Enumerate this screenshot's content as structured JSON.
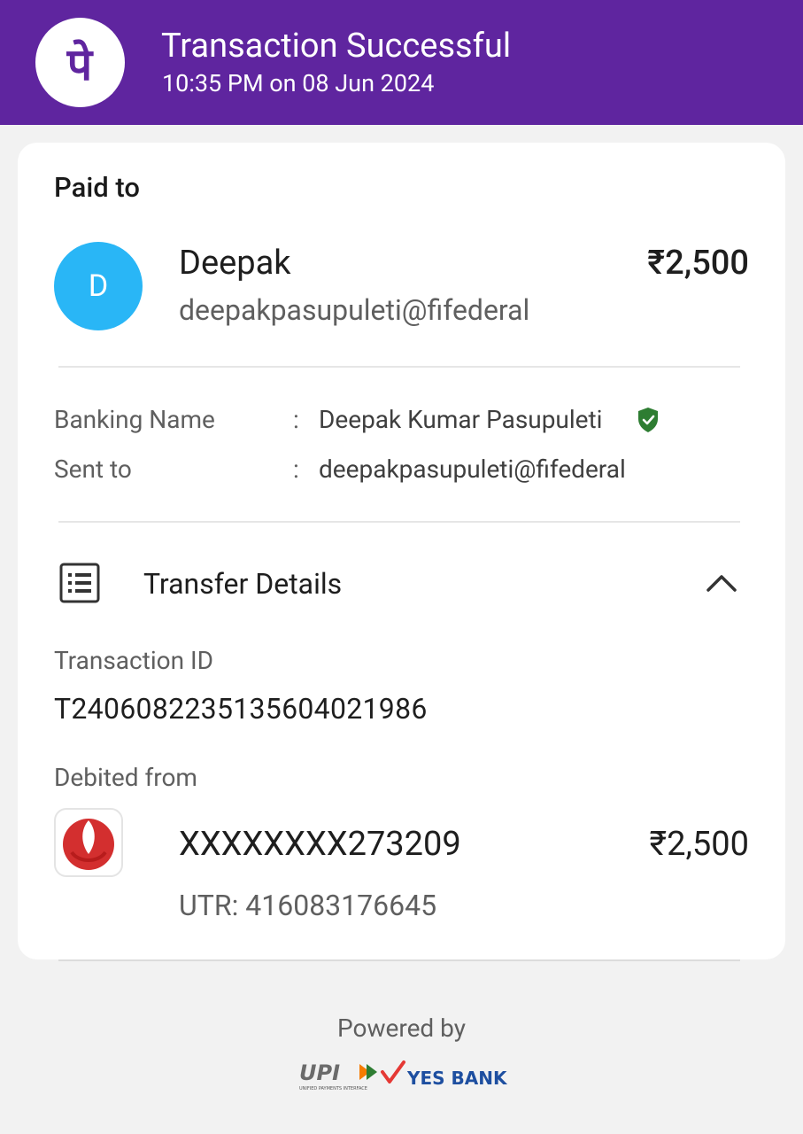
{
  "header": {
    "title": "Transaction Successful",
    "subtitle": "10:35 PM on 08 Jun 2024",
    "logo_icon": "phonepe-logo-icon",
    "background": "#5f259f"
  },
  "card": {
    "paid_to_label": "Paid to",
    "payee": {
      "avatar_letter": "D",
      "avatar_color": "#29b6f6",
      "name": "Deepak",
      "vpa": "deepakpasupuleti@fifederal",
      "amount": "₹2,500"
    },
    "details": [
      {
        "label": "Banking Name",
        "separator": ":",
        "value": "Deepak Kumar Pasupuleti",
        "verified_icon": "verified-shield-icon"
      },
      {
        "label": "Sent to",
        "separator": ":",
        "value": "deepakpasupuleti@fifederal"
      }
    ],
    "transfer_details": {
      "title": "Transfer Details",
      "icon": "receipt-list-icon",
      "toggle_icon": "chevron-up-icon",
      "transaction_id_label": "Transaction ID",
      "transaction_id": "T2406082235135604021986",
      "debited_from_label": "Debited from",
      "account": "XXXXXXXX273209",
      "account_amount": "₹2,500",
      "utr": "UTR: 416083176645",
      "bank_icon": "federal-bank-logo-icon"
    }
  },
  "footer": {
    "powered_by": "Powered by",
    "upi_logo": "UPI",
    "upi_tagline": "UNIFIED PAYMENTS INTERFACE",
    "bank_logo": "YES BANK"
  }
}
